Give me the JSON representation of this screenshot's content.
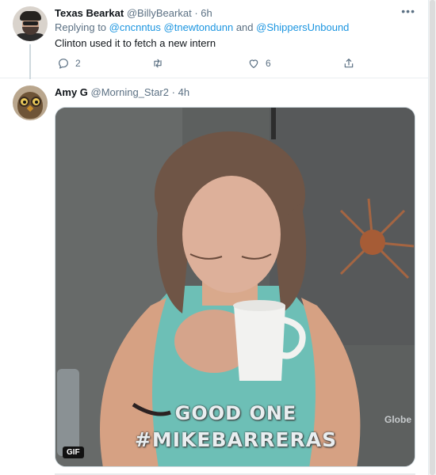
{
  "tweet1": {
    "display_name": "Texas Bearkat",
    "handle": "@BillyBearkat",
    "separator": "·",
    "time": "6h",
    "replying_prefix": "Replying to",
    "mention1": "@cncnntus",
    "mention2": "@tnewtondunn",
    "and": "and",
    "mention3": "@ShippersUnbound",
    "text": "Clinton used it to fetch a new intern",
    "replies": "2",
    "retweets": "",
    "likes": "6",
    "more_icon": "more-dots-icon"
  },
  "tweet2": {
    "display_name": "Amy G",
    "handle": "@Morning_Star2",
    "separator": "·",
    "time": "4h",
    "media": {
      "caption_line1": "GOOD ONE",
      "caption_line2": "#MIKEBARRERAS",
      "watermark": "Globe",
      "badge": "GIF"
    }
  },
  "colors": {
    "link": "#1b95e0",
    "muted": "#5b7083",
    "text": "#0f1419"
  }
}
